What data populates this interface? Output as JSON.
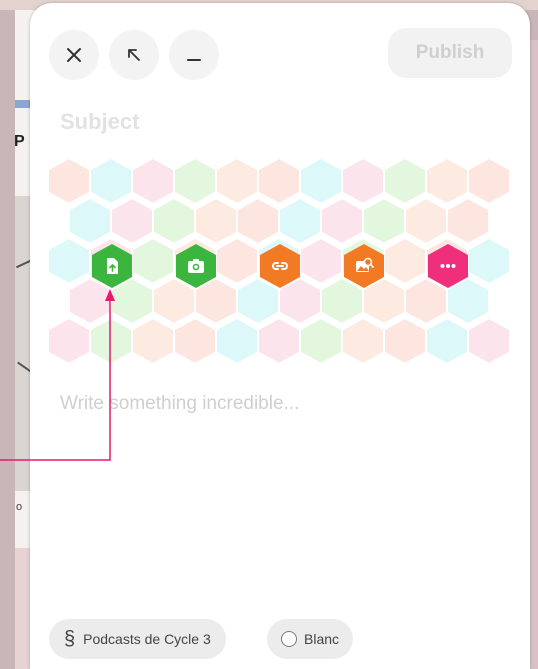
{
  "header": {
    "close_icon": "close-icon",
    "expand_icon": "arrow-up-left-icon",
    "minimize_icon": "minimize-icon",
    "publish_label": "Publish"
  },
  "composer": {
    "subject_placeholder": "Subject",
    "body_placeholder": "Write something incredible..."
  },
  "attachments": [
    {
      "icon": "file-upload-icon",
      "color": "#3cb53f"
    },
    {
      "icon": "camera-icon",
      "color": "#3cb53f"
    },
    {
      "icon": "link-icon",
      "color": "#f37a24"
    },
    {
      "icon": "image-search-icon",
      "color": "#f37a24"
    },
    {
      "icon": "more-icon",
      "color": "#ef2f7c"
    }
  ],
  "footer": {
    "category_symbol": "§",
    "category_label": "Podcasts de Cycle 3",
    "color_label": "Blanc"
  },
  "colors": {
    "accent_pink": "#e8196f",
    "hex_palette": [
      "#fde6e0",
      "#dcf8f8",
      "#fce4ec",
      "#e3f7de",
      "#fdebe2"
    ]
  }
}
